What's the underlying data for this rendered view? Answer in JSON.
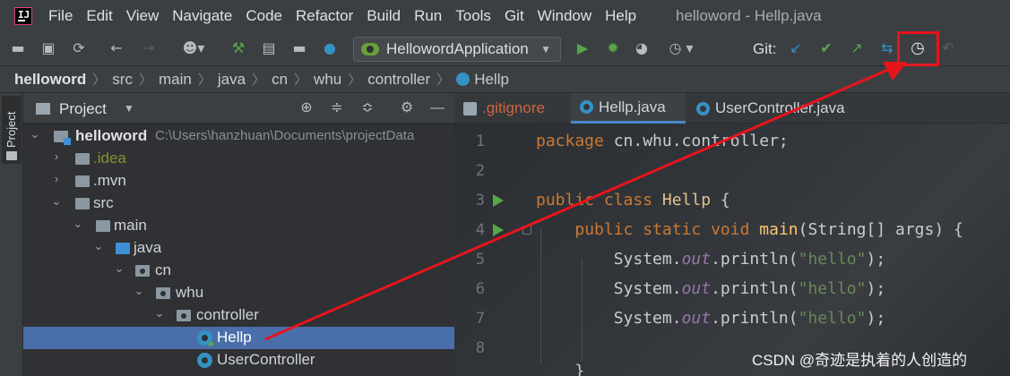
{
  "menubar": {
    "items": [
      "File",
      "Edit",
      "View",
      "Navigate",
      "Code",
      "Refactor",
      "Build",
      "Run",
      "Tools",
      "Git",
      "Window",
      "Help"
    ],
    "window_title": "helloword - Hellp.java"
  },
  "toolbar": {
    "run_config": "HellowordApplication",
    "git_label": "Git:",
    "icons": [
      "open-folder-icon",
      "save-icon",
      "sync-icon",
      "back-icon",
      "forward-icon",
      "user-icon",
      "build-hammer-icon",
      "file-icon",
      "folder-icon",
      "class-icon",
      "run-icon",
      "debug-icon",
      "coverage-icon",
      "profile-icon",
      "git-update-icon",
      "git-commit-icon",
      "git-push-icon",
      "git-compare-icon",
      "git-history-icon"
    ],
    "colors": {
      "git_update": "#3592c4",
      "git_commit": "#57a64a",
      "highlight": "#e8141c"
    }
  },
  "breadcrumb": [
    "helloword",
    "src",
    "main",
    "java",
    "cn",
    "whu",
    "controller",
    "Hellp"
  ],
  "side_strip": {
    "tab": "Project"
  },
  "project_panel": {
    "title": "Project",
    "tree": [
      {
        "label": "helloword",
        "path": "C:\\Users\\hanzhuan\\Documents\\projectData",
        "type": "module"
      },
      {
        "label": ".idea",
        "type": "folder-ignored"
      },
      {
        "label": ".mvn",
        "type": "folder"
      },
      {
        "label": "src",
        "type": "folder"
      },
      {
        "label": "main",
        "type": "folder"
      },
      {
        "label": "java",
        "type": "source-folder"
      },
      {
        "label": "cn",
        "type": "package"
      },
      {
        "label": "whu",
        "type": "package"
      },
      {
        "label": "controller",
        "type": "package"
      },
      {
        "label": "Hellp",
        "type": "class",
        "selected": true
      },
      {
        "label": "UserController",
        "type": "class"
      }
    ]
  },
  "editor": {
    "tabs": [
      {
        "label": ".gitignore",
        "active": false
      },
      {
        "label": "Hellp.java",
        "active": true
      },
      {
        "label": "UserController.java",
        "active": false
      }
    ],
    "line_numbers": [
      "1",
      "2",
      "3",
      "4",
      "5",
      "6",
      "7",
      "8"
    ],
    "code": {
      "line1_kw": "package",
      "line1_rest": " cn.whu.controller;",
      "line3_kw": "public class",
      "line3_name": "Hellp",
      "line3_rest": " {",
      "line4_kw": "public static void",
      "line4_fn": "main",
      "line4_rest": "(String[] args) {",
      "print_prefix": "System.",
      "print_field": "out",
      "print_call": ".println(",
      "print_str": "\"hello\"",
      "print_end": ");",
      "line8": "}"
    }
  },
  "watermark": "CSDN @奇迹是执着的人创造的"
}
